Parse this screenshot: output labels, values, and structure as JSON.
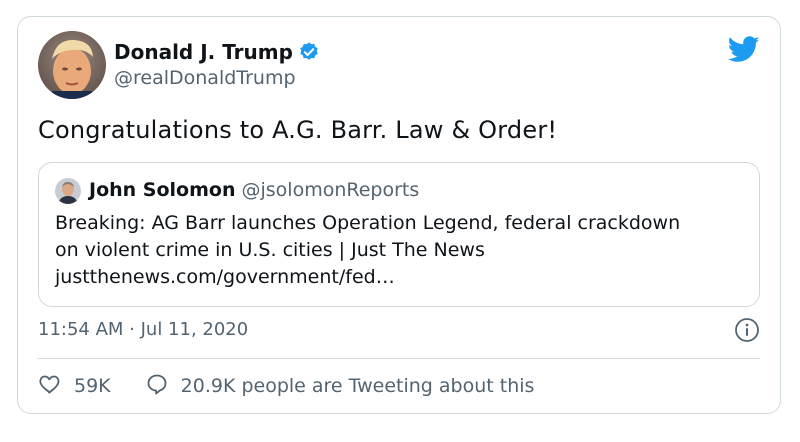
{
  "tweet": {
    "author": {
      "display_name": "Donald J. Trump",
      "handle": "@realDonaldTrump",
      "verified": true
    },
    "text": "Congratulations to A.G. Barr. Law & Order!",
    "quoted": {
      "display_name": "John Solomon",
      "handle": "@jsolomonReports",
      "lines": [
        "Breaking: AG Barr launches Operation Legend, federal crackdown",
        "on violent crime in U.S. cities | Just The News",
        "justthenews.com/government/fed…"
      ]
    },
    "timestamp": "11:54 AM · Jul 11, 2020",
    "likes": "59K",
    "conversation": "20.9K people are Tweeting about this"
  },
  "icons": {
    "verified": "verified-badge-icon",
    "brand": "twitter-bird-icon",
    "info": "info-icon",
    "like": "heart-icon",
    "reply": "speech-bubble-icon"
  },
  "colors": {
    "brand": "#1d9bf0",
    "text": "#0f1419",
    "secondary": "#536471",
    "border": "#cfd9de"
  }
}
